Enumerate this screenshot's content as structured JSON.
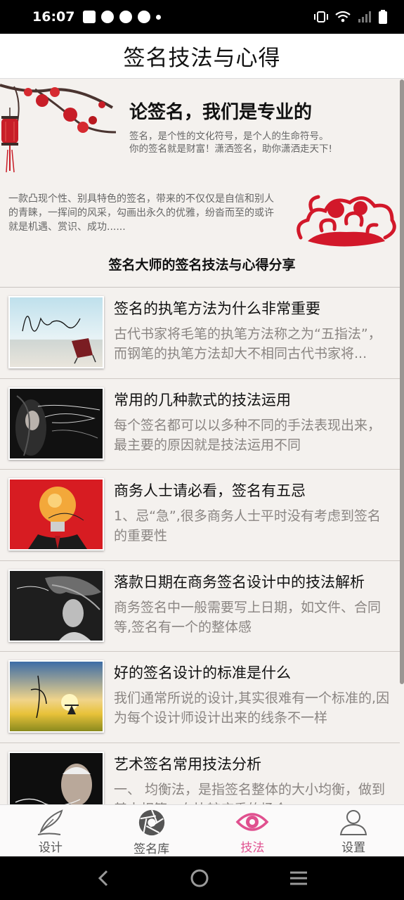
{
  "status_bar": {
    "time": "16:07"
  },
  "app_title": "签名技法与心得",
  "banner": {
    "headline": "论签名，我们是专业的",
    "subline1": "签名，是个性的文化符号，是个人的生命符号。",
    "subline2": "你的签名就是财富！潇洒签名，助你潇洒走天下!",
    "description": "一款凸现个性、别具特色的签名，带来的不仅仅是自信和别人的青睐，一挥间的风采，勾画出永久的优雅，纷沓而至的或许就是机遇、赏识、成功......"
  },
  "section_title": "签名大师的签名技法与心得分享",
  "articles": [
    {
      "title": "签名的执笔方法为什么非常重要",
      "desc": "古代书家将毛笔的执笔方法称之为“五指法”，而钢笔的执笔方法却大不相同古代书家将..."
    },
    {
      "title": "常用的几种款式的技法运用",
      "desc": "每个签名都可以以多种不同的手法表现出来，最主要的原因就是技法运用不同"
    },
    {
      "title": "商务人士请必看，签名有五忌",
      "desc": "1、忌“急”,很多商务人士平时没有考虑到签名的重要性"
    },
    {
      "title": "落款日期在商务签名设计中的技法解析",
      "desc": "商务签名中一般需要写上日期，如文件、合同等,签名有一个的整体感"
    },
    {
      "title": "好的签名设计的标准是什么",
      "desc": "我们通常所说的设计,其实很难有一个标准的,因为每个设计师设计出来的线条不一样"
    },
    {
      "title": "艺术签名常用技法分析",
      "desc": "一、 均衡法，是指签名整体的大小均衡，做到基本相等，在比较庄重的场合"
    }
  ],
  "bottom_nav": [
    {
      "label": "设计",
      "icon": "quill-icon"
    },
    {
      "label": "签名库",
      "icon": "aperture-icon"
    },
    {
      "label": "技法",
      "icon": "eye-icon",
      "active": true
    },
    {
      "label": "设置",
      "icon": "user-icon"
    }
  ],
  "colors": {
    "accent": "#e0508f",
    "background": "#f4f1ee",
    "red": "#d2182a"
  }
}
